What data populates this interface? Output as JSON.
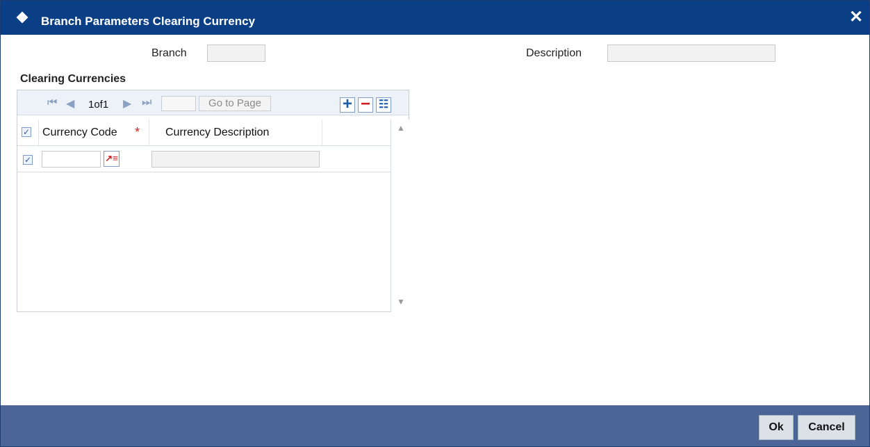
{
  "window": {
    "title": "Branch Parameters Clearing Currency",
    "close_symbol": "✕"
  },
  "form": {
    "branch_label": "Branch",
    "branch_value": "",
    "description_label": "Description",
    "description_value": ""
  },
  "section": {
    "title": "Clearing Currencies"
  },
  "pagination": {
    "text": "1of1",
    "page_value": "",
    "go_to_page": "Go to Page"
  },
  "table": {
    "headers": {
      "currency_code": "Currency Code",
      "required_mark": "*",
      "currency_description": "Currency Description"
    },
    "rows": [
      {
        "currency_code": "",
        "currency_description": ""
      }
    ]
  },
  "footer": {
    "ok": "Ok",
    "cancel": "Cancel"
  },
  "colors": {
    "titlebar": "#0a3f86",
    "footer": "#4b6597",
    "required": "#d11f1f",
    "lookup_icon": "#d11f1f"
  },
  "icons": [
    "diamond-icon",
    "close-icon",
    "first-page-icon",
    "previous-page-icon",
    "next-page-icon",
    "last-page-icon",
    "add-row-icon",
    "delete-row-icon",
    "single-view-icon",
    "lookup-icon",
    "scroll-up-icon",
    "scroll-down-icon"
  ]
}
